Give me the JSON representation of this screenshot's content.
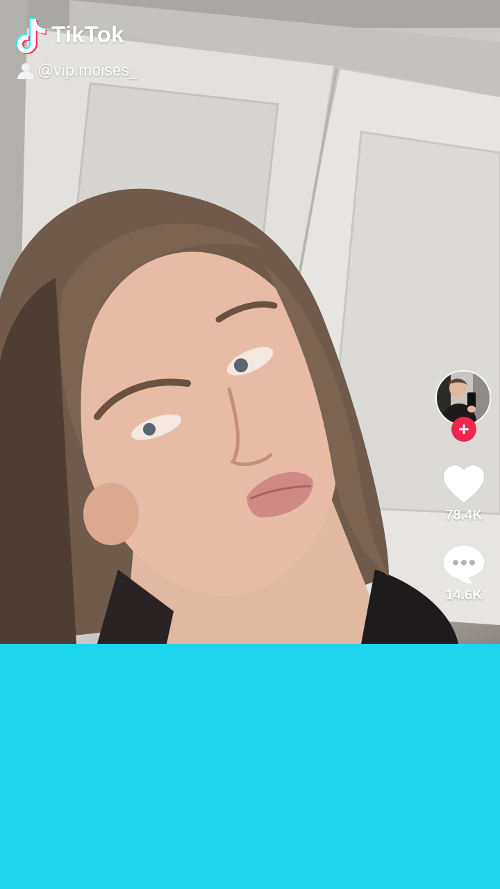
{
  "app": {
    "name": "TikTok",
    "logo_icon": "tiktok-note-icon"
  },
  "creator": {
    "handle": "@vip.moises_",
    "user_icon": "user-icon"
  },
  "actions": {
    "follow_icon": "plus-icon",
    "likes": "78.4K",
    "like_icon": "heart-icon",
    "comments": "14.6K",
    "comment_icon": "comment-bubble-icon"
  },
  "colors": {
    "follow_badge": "#f0264e",
    "bottom_panel": "#1fd5ec",
    "logo_cyan": "#25f4ee",
    "logo_red": "#fe2c55"
  }
}
